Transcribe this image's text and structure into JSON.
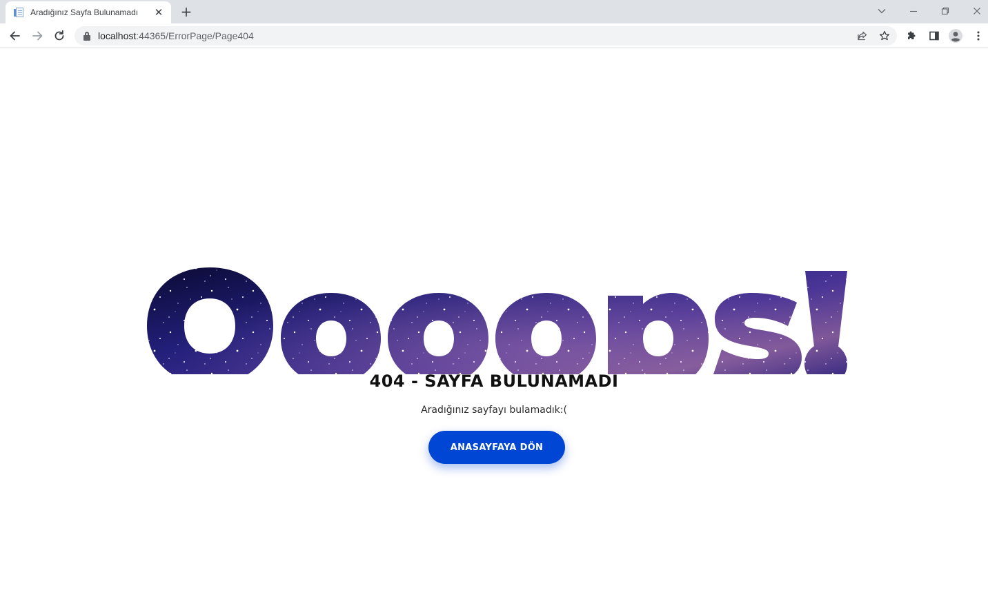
{
  "browser": {
    "tab": {
      "title": "Aradığınız Sayfa Bulunamadı",
      "close_glyph": "✕"
    },
    "new_tab_glyph": "+",
    "window_controls": {
      "tabsearch_glyph": "⌄",
      "minimize_glyph": "—",
      "restore_glyph": "❐",
      "close_glyph": "✕"
    },
    "address": {
      "host": "localhost",
      "path": ":44365/ErrorPage/Page404"
    }
  },
  "page": {
    "big_word": "Oooops!",
    "heading": "404 - SAYFA BULUNAMADI",
    "subtext": "Aradığınız sayfayı bulamadık:(",
    "home_button_label": "ANASAYFAYA DÖN"
  },
  "colors": {
    "accent_button": "#0046d5",
    "galaxy_deep": "#0d0b3a",
    "galaxy_mid": "#2d2a8c",
    "galaxy_purple": "#5a3b9e",
    "galaxy_pink": "#8a5a9e"
  }
}
